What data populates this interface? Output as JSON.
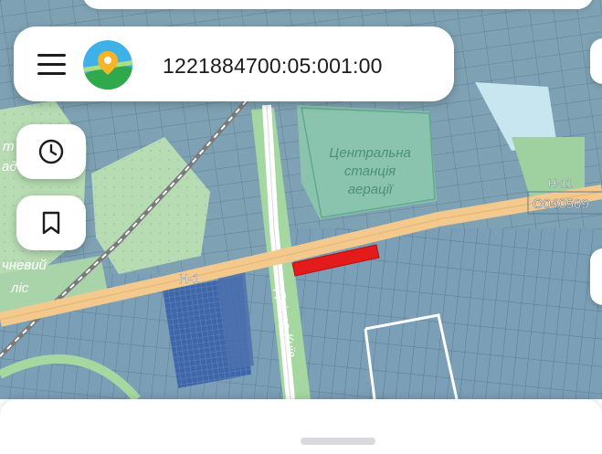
{
  "search": {
    "value": "1221884700:05:001:00",
    "placeholder": ""
  },
  "map": {
    "labels": {
      "station_line1": "Центральна",
      "station_line2": "станція",
      "station_line3": "аерації",
      "road_h11_a": "Н-11",
      "road_h11_b": "Н-1",
      "road_code": "О040509",
      "forest_line1": "чневий",
      "forest_line2": "ліс",
      "street_vertical": "Дніпро-Київ",
      "left_edge_a": "т",
      "left_edge_b": "ад"
    },
    "colors": {
      "parcel_fill": "#7ea2b3",
      "parcel_outline": "#5d7f95",
      "green_area": "#b9dfb7",
      "road": "#f3c98e",
      "selected_parcel": "#e31b1b"
    }
  },
  "icons": {
    "menu": "hamburger-menu-icon",
    "logo": "map-pin-logo-icon",
    "history": "clock-icon",
    "bookmark": "bookmark-icon"
  }
}
